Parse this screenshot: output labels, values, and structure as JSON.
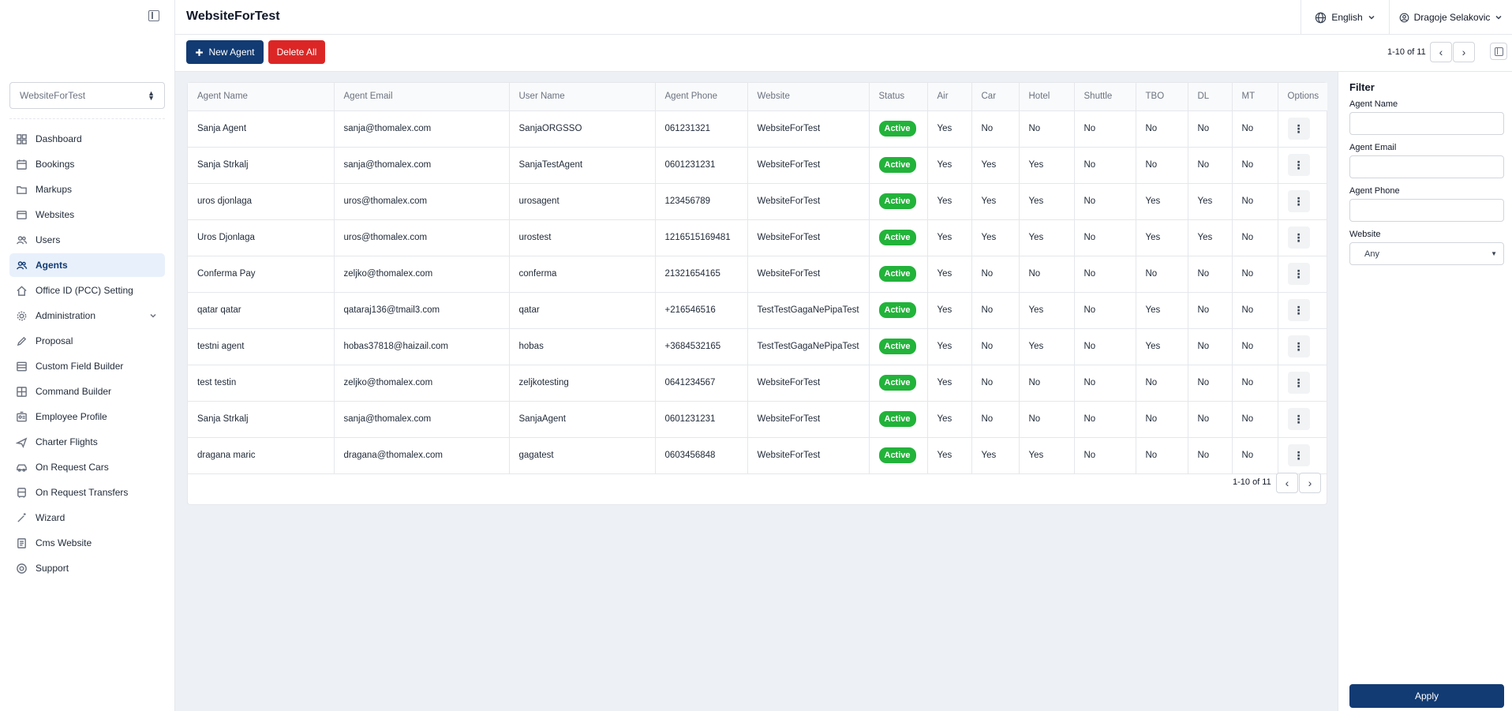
{
  "app": {
    "title": "WebsiteForTest"
  },
  "header": {
    "language": "English",
    "user": "Dragoje Selakovic"
  },
  "sidebar": {
    "website_select": "WebsiteForTest",
    "items": [
      {
        "label": "Dashboard",
        "icon": "dashboard-icon"
      },
      {
        "label": "Bookings",
        "icon": "calendar-icon"
      },
      {
        "label": "Markups",
        "icon": "folder-icon"
      },
      {
        "label": "Websites",
        "icon": "browser-icon"
      },
      {
        "label": "Users",
        "icon": "users-icon"
      },
      {
        "label": "Agents",
        "icon": "agents-icon",
        "active": true
      },
      {
        "label": "Office ID (PCC) Setting",
        "icon": "home-icon"
      },
      {
        "label": "Administration",
        "icon": "settings-icon",
        "expandable": true
      },
      {
        "label": "Proposal",
        "icon": "pen-icon"
      },
      {
        "label": "Custom Field Builder",
        "icon": "form-icon"
      },
      {
        "label": "Command Builder",
        "icon": "grid-icon"
      },
      {
        "label": "Employee Profile",
        "icon": "id-card-icon"
      },
      {
        "label": "Charter Flights",
        "icon": "plane-icon"
      },
      {
        "label": "On Request Cars",
        "icon": "car-icon"
      },
      {
        "label": "On Request Transfers",
        "icon": "bus-icon"
      },
      {
        "label": "Wizard",
        "icon": "wand-icon"
      },
      {
        "label": "Cms Website",
        "icon": "document-icon"
      },
      {
        "label": "Support",
        "icon": "support-icon"
      }
    ]
  },
  "toolbar": {
    "new_label": "New Agent",
    "delete_label": "Delete All",
    "pager": "1-10 of 11"
  },
  "table": {
    "columns": [
      "Agent Name",
      "Agent Email",
      "User Name",
      "Agent Phone",
      "Website",
      "Status",
      "Air",
      "Car",
      "Hotel",
      "Shuttle",
      "TBO",
      "DL",
      "MT",
      "Options"
    ],
    "rows": [
      [
        "Sanja Agent",
        "sanja@thomalex.com",
        "SanjaORGSSO",
        "061231321",
        "WebsiteForTest",
        "Active",
        "Yes",
        "No",
        "No",
        "No",
        "No",
        "No",
        "No"
      ],
      [
        "Sanja Strkalj",
        "sanja@thomalex.com",
        "SanjaTestAgent",
        "0601231231",
        "WebsiteForTest",
        "Active",
        "Yes",
        "Yes",
        "Yes",
        "No",
        "No",
        "No",
        "No"
      ],
      [
        "uros djonlaga",
        "uros@thomalex.com",
        "urosagent",
        "123456789",
        "WebsiteForTest",
        "Active",
        "Yes",
        "Yes",
        "Yes",
        "No",
        "Yes",
        "Yes",
        "No"
      ],
      [
        "Uros Djonlaga",
        "uros@thomalex.com",
        "urostest",
        "1216515169481",
        "WebsiteForTest",
        "Active",
        "Yes",
        "Yes",
        "Yes",
        "No",
        "Yes",
        "Yes",
        "No"
      ],
      [
        "Conferma Pay",
        "zeljko@thomalex.com",
        "conferma",
        "21321654165",
        "WebsiteForTest",
        "Active",
        "Yes",
        "No",
        "No",
        "No",
        "No",
        "No",
        "No"
      ],
      [
        "qatar qatar",
        "qataraj136@tmail3.com",
        "qatar",
        "+216546516",
        "TestTestGagaNePipaTest",
        "Active",
        "Yes",
        "No",
        "Yes",
        "No",
        "Yes",
        "No",
        "No"
      ],
      [
        "testni agent",
        "hobas37818@haizail.com",
        "hobas",
        "+3684532165",
        "TestTestGagaNePipaTest",
        "Active",
        "Yes",
        "No",
        "Yes",
        "No",
        "Yes",
        "No",
        "No"
      ],
      [
        "test testin",
        "zeljko@thomalex.com",
        "zeljkotesting",
        "0641234567",
        "WebsiteForTest",
        "Active",
        "Yes",
        "No",
        "No",
        "No",
        "No",
        "No",
        "No"
      ],
      [
        "Sanja Strkalj",
        "sanja@thomalex.com",
        "SanjaAgent",
        "0601231231",
        "WebsiteForTest",
        "Active",
        "Yes",
        "No",
        "No",
        "No",
        "No",
        "No",
        "No"
      ],
      [
        "dragana maric",
        "dragana@thomalex.com",
        "gagatest",
        "0603456848",
        "WebsiteForTest",
        "Active",
        "Yes",
        "Yes",
        "Yes",
        "No",
        "No",
        "No",
        "No"
      ]
    ],
    "pager": "1-10 of 11"
  },
  "filter": {
    "title": "Filter",
    "agent_name_label": "Agent Name",
    "agent_email_label": "Agent Email",
    "agent_phone_label": "Agent Phone",
    "website_label": "Website",
    "website_value": "Any",
    "apply_label": "Apply"
  },
  "colors": {
    "primary": "#123b73",
    "danger": "#dc2626",
    "success": "#22b33a",
    "background": "#edf1f5"
  }
}
